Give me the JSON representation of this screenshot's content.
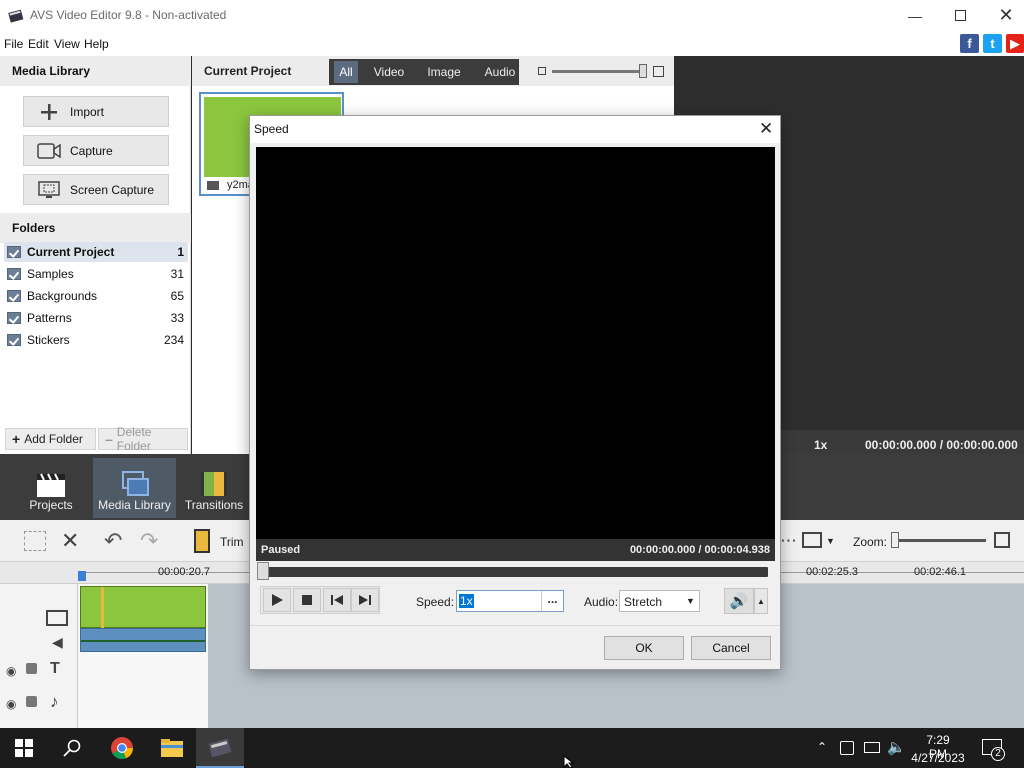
{
  "window": {
    "title": "AVS Video Editor 9.8 - Non-activated",
    "controls": [
      "minimize-icon",
      "maximize-icon",
      "close-icon"
    ]
  },
  "menu": {
    "items": [
      "File",
      "Edit",
      "View",
      "Help"
    ]
  },
  "social": [
    "facebook-icon",
    "twitter-icon",
    "youtube-icon"
  ],
  "media_library": {
    "title": "Media Library",
    "buttons": [
      {
        "label": "Import",
        "icon": "plus-icon"
      },
      {
        "label": "Capture",
        "icon": "camera-icon"
      },
      {
        "label": "Screen Capture",
        "icon": "screen-capture-icon"
      }
    ],
    "folders_title": "Folders",
    "folders": [
      {
        "name": "Current Project",
        "count": "1"
      },
      {
        "name": "Samples",
        "count": "31"
      },
      {
        "name": "Backgrounds",
        "count": "65"
      },
      {
        "name": "Patterns",
        "count": "33"
      },
      {
        "name": "Stickers",
        "count": "234"
      }
    ],
    "add_folder": "Add Folder",
    "delete_folder": "Delete Folder"
  },
  "project": {
    "title": "Current Project",
    "filters": [
      "All",
      "Video",
      "Image",
      "Audio"
    ],
    "active_filter": "All",
    "thumb_label": "y2ma"
  },
  "preview": {
    "speed": "1x",
    "time": "00:00:00.000 / 00:00:00.000"
  },
  "tabs": [
    {
      "label": "Projects",
      "icon": "clapperboard-icon"
    },
    {
      "label": "Media Library",
      "icon": "film-stack-icon"
    },
    {
      "label": "Transitions",
      "icon": "transition-icon"
    }
  ],
  "timeline": {
    "trim_label": "Trim",
    "zoom_label": "Zoom:",
    "ruler": [
      "00:00:20.7",
      "00:02:25.3",
      "00:02:46.1"
    ]
  },
  "dialog": {
    "title": "Speed",
    "status": "Paused",
    "time": "00:00:00.000  /  00:00:04.938",
    "speed_label": "Speed:",
    "speed_value": "1x",
    "speed_more": "...",
    "audio_label": "Audio:",
    "audio_value": "Stretch",
    "ok": "OK",
    "cancel": "Cancel"
  },
  "taskbar": {
    "time": "7:29 PM",
    "date": "4/27/2023",
    "notifications": "2"
  },
  "colors": {
    "accent": "#5b8fc9",
    "clip_green": "#8cc63f",
    "dark": "#3c3c3c"
  }
}
